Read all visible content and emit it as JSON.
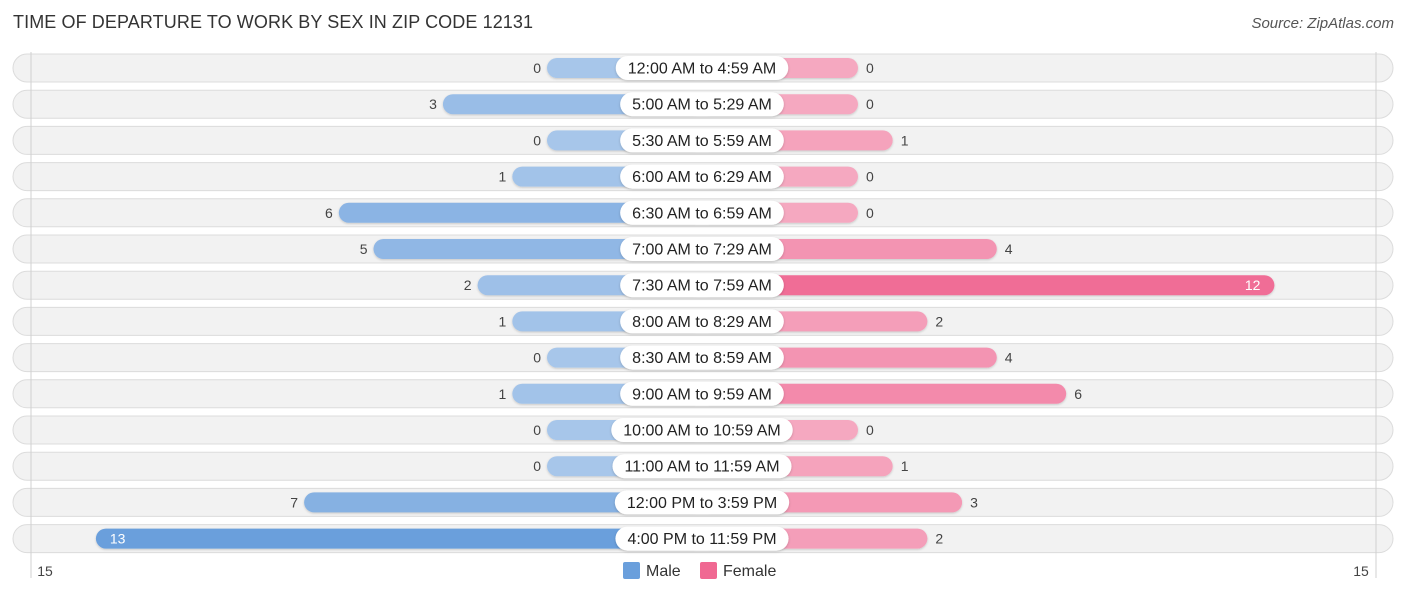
{
  "header": {
    "title": "TIME OF DEPARTURE TO WORK BY SEX IN ZIP CODE 12131",
    "source": "Source: ZipAtlas.com"
  },
  "colors": {
    "male": "#6a9fdc",
    "male_light": "#a7c6ea",
    "female": "#f06892",
    "female_light": "#f5a8c0",
    "row_bg": "#f2f2f2"
  },
  "chart_data": {
    "type": "bar",
    "orientation": "horizontal-diverging",
    "title": "TIME OF DEPARTURE TO WORK BY SEX IN ZIP CODE 12131",
    "categories": [
      "12:00 AM to 4:59 AM",
      "5:00 AM to 5:29 AM",
      "5:30 AM to 5:59 AM",
      "6:00 AM to 6:29 AM",
      "6:30 AM to 6:59 AM",
      "7:00 AM to 7:29 AM",
      "7:30 AM to 7:59 AM",
      "8:00 AM to 8:29 AM",
      "8:30 AM to 8:59 AM",
      "9:00 AM to 9:59 AM",
      "10:00 AM to 10:59 AM",
      "11:00 AM to 11:59 AM",
      "12:00 PM to 3:59 PM",
      "4:00 PM to 11:59 PM"
    ],
    "series": [
      {
        "name": "Male",
        "values": [
          0,
          3,
          0,
          1,
          6,
          5,
          2,
          1,
          0,
          1,
          0,
          0,
          7,
          13
        ]
      },
      {
        "name": "Female",
        "values": [
          0,
          0,
          1,
          0,
          0,
          4,
          12,
          2,
          4,
          6,
          0,
          1,
          3,
          2
        ]
      }
    ],
    "axis": {
      "left_label": "15",
      "right_label": "15",
      "range": [
        -15,
        15
      ]
    },
    "legend": {
      "position": "bottom-center",
      "items": [
        "Male",
        "Female"
      ]
    },
    "grid": false
  }
}
